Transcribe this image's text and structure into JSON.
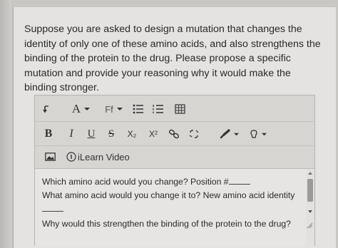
{
  "question": {
    "text": "Suppose you are asked to design a mutation that changes the identity of only one of these amino acids, and also strengthens the binding of the protein to the drug. Please propose a specific mutation and provide your reasoning why it would make the binding stronger."
  },
  "toolbar": {
    "row1": {
      "font_color_label": "A",
      "font_size_label": "Ff",
      "icons": [
        "paragraph-arrow-icon",
        "font-color-icon",
        "font-size-icon",
        "bullet-list-icon",
        "numbered-list-icon",
        "table-icon"
      ]
    },
    "row2": {
      "bold_label": "B",
      "italic_label": "I",
      "underline_label": "U",
      "strike_label": "S",
      "subscript_label": "X₂",
      "superscript_label": "X²",
      "icons": [
        "bold-icon",
        "italic-icon",
        "underline-icon",
        "strikethrough-icon",
        "subscript-icon",
        "superscript-icon",
        "link-icon",
        "unlink-icon",
        "highlight-pen-icon",
        "paint-icon"
      ]
    },
    "row3": {
      "ilearn_label": "iLearn Video",
      "icons": [
        "image-icon",
        "ilearn-video-icon"
      ]
    }
  },
  "content": {
    "line1_prefix": "Which amino acid would you change? Position #",
    "line2": "What amino acid would you change it to? New amino acid identity",
    "line4": "Why would this strengthen the binding of the protein to the drug?"
  }
}
